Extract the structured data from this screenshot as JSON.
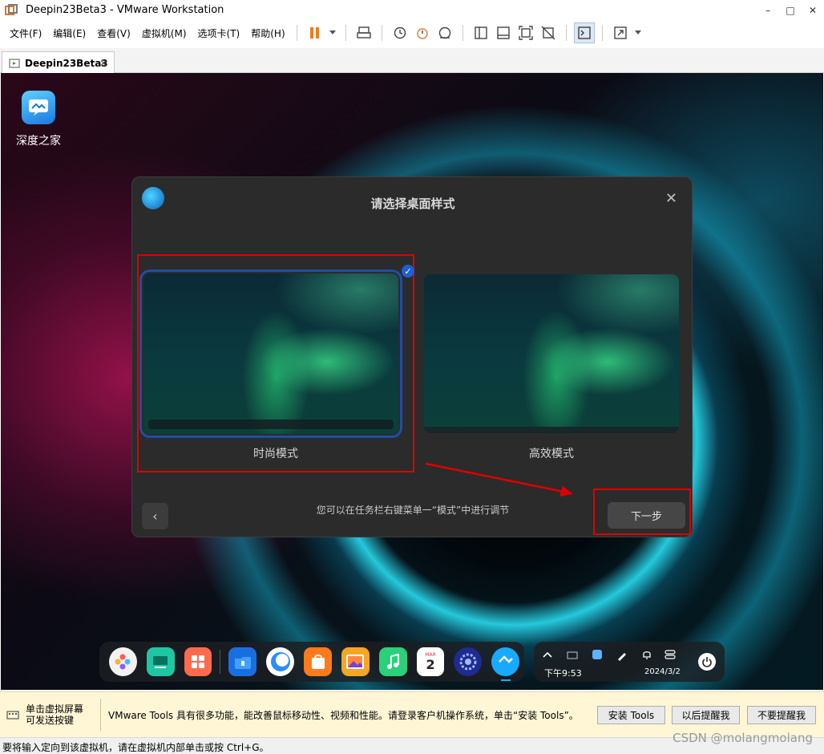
{
  "window": {
    "title": "Deepin23Beta3 - VMware Workstation",
    "minimize": "–",
    "maximize": "□",
    "close": "✕"
  },
  "menu": {
    "items": [
      "文件(F)",
      "编辑(E)",
      "查看(V)",
      "虚拟机(M)",
      "选项卡(T)",
      "帮助(H)"
    ]
  },
  "tab": {
    "label": "Deepin23Beta3",
    "close": "✕"
  },
  "desktop": {
    "icon_label": "深度之家"
  },
  "dialog": {
    "title": "请选择桌面样式",
    "close": "✕",
    "modes": [
      {
        "label": "时尚模式",
        "selected": true
      },
      {
        "label": "高效模式",
        "selected": false
      }
    ],
    "check": "✓",
    "back": "‹",
    "hint": "您可以在任务栏右键菜单一“模式”中进行调节",
    "next": "下一步"
  },
  "taskbar": {
    "time": "下午9:53",
    "date": "2024/3/2",
    "calendar_month": "MAR",
    "calendar_day": "2"
  },
  "tools_bar": {
    "left_line1": "单击虚拟屏幕",
    "left_line2": "可发送按键",
    "message": "VMware Tools 具有很多功能，能改善鼠标移动性、视频和性能。请登录客户机操作系统，单击“安装 Tools”。",
    "btn_install": "安装 Tools",
    "btn_later": "以后提醒我",
    "btn_never": "不要提醒我"
  },
  "status": {
    "text": "要将输入定向到该虚拟机，请在虚拟机内部单击或按 Ctrl+G。",
    "watermark": "CSDN @molangmolang"
  },
  "colors": {
    "highlight_red": "#e00000",
    "dialog_bg": "#2b2b2b",
    "selection_blue": "#1f4ea6"
  }
}
